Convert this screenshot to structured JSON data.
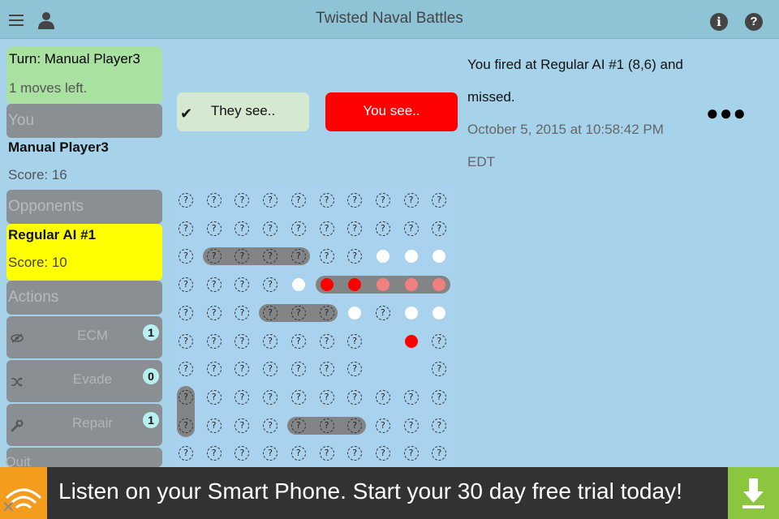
{
  "header": {
    "title": "Twisted Naval Battles"
  },
  "status": {
    "turn": "Turn: Manual Player3",
    "moves_left": "1 moves left."
  },
  "you": {
    "section_label": "You",
    "name": "Manual Player3",
    "score": "Score: 16"
  },
  "opponents": {
    "section_label": "Opponents",
    "name": "Regular AI #1",
    "score": "Score: 10"
  },
  "actions": {
    "section_label": "Actions",
    "items": [
      {
        "label": "ECM",
        "count": "1",
        "icon": "eye-slash-icon"
      },
      {
        "label": "Evade",
        "count": "0",
        "icon": "shuffle-icon"
      },
      {
        "label": "Repair",
        "count": "1",
        "icon": "wrench-icon"
      }
    ],
    "next_label": "Quit"
  },
  "view_toggle": {
    "they_see": "They see..",
    "you_see": "You see..",
    "selected": "they_see"
  },
  "message": {
    "text": "You fired at Regular AI #1 (8,6) and missed.",
    "timestamp": "October 5, 2015 at 10:58:42 PM EDT"
  },
  "board": {
    "rows": 10,
    "cols": 10,
    "unknown_symbol": "?",
    "misses": [
      [
        7,
        2
      ],
      [
        8,
        2
      ],
      [
        9,
        2
      ],
      [
        4,
        3
      ],
      [
        6,
        4
      ],
      [
        8,
        4
      ],
      [
        9,
        4
      ]
    ],
    "hits": [
      [
        5,
        3
      ],
      [
        6,
        3
      ],
      [
        8,
        5
      ]
    ],
    "sunk_hits": [
      [
        7,
        3
      ],
      [
        8,
        3
      ],
      [
        9,
        3
      ]
    ],
    "empty": [
      [
        7,
        5
      ],
      [
        7,
        6
      ],
      [
        8,
        6
      ]
    ],
    "ships": [
      {
        "col": 1,
        "row": 2,
        "length": 4,
        "orientation": "h"
      },
      {
        "col": 5,
        "row": 3,
        "length": 5,
        "orientation": "h"
      },
      {
        "col": 3,
        "row": 4,
        "length": 3,
        "orientation": "h"
      },
      {
        "col": 0,
        "row": 7,
        "length": 2,
        "orientation": "v"
      },
      {
        "col": 4,
        "row": 8,
        "length": 3,
        "orientation": "h"
      }
    ]
  },
  "ad": {
    "text": "Listen on your Smart Phone. Start your 30 day free trial today!"
  }
}
